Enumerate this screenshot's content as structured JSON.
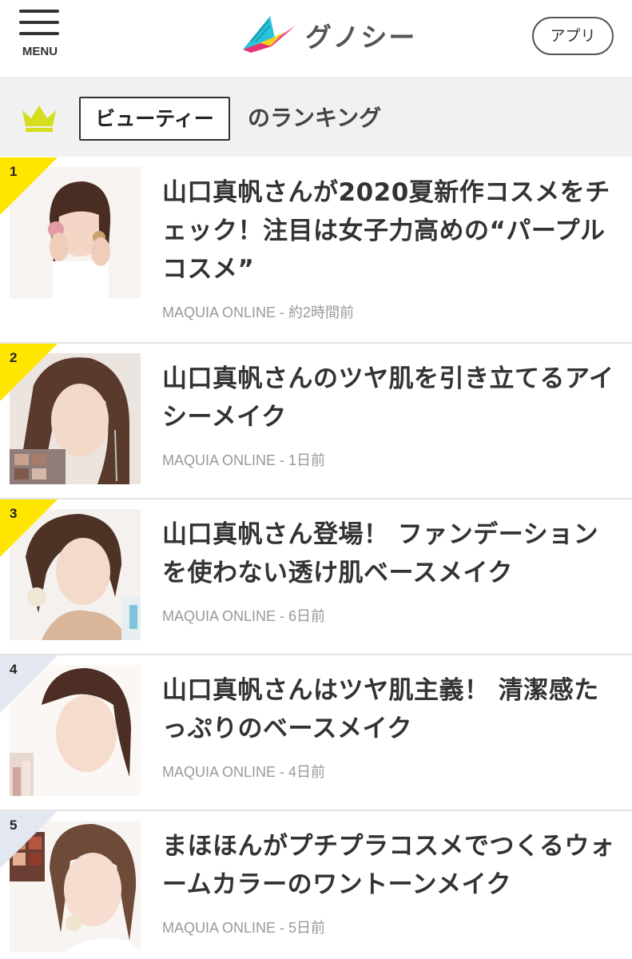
{
  "header": {
    "menu_label": "MENU",
    "logo_text": "グノシー",
    "app_button": "アプリ"
  },
  "ranking": {
    "category": "ビューティー",
    "suffix": "のランキング"
  },
  "colors": {
    "badge_top": "#ffe600",
    "badge_other": "#e3e8f0",
    "crown": "#d4dd1f",
    "meta": "#999999"
  },
  "articles": [
    {
      "rank": "1",
      "title": "山口真帆さんが2020夏新作コスメをチェック！注目は女子力高めの“パープルコスメ”",
      "source": "MAQUIA ONLINE",
      "time": "約2時間前"
    },
    {
      "rank": "2",
      "title": "山口真帆さんのツヤ肌を引き立てるアイシーメイク",
      "source": "MAQUIA ONLINE",
      "time": "1日前"
    },
    {
      "rank": "3",
      "title": "山口真帆さん登場！ ファンデーションを使わない透け肌ベースメイク",
      "source": "MAQUIA ONLINE",
      "time": "6日前"
    },
    {
      "rank": "4",
      "title": "山口真帆さんはツヤ肌主義！ 清潔感たっぷりのベースメイク",
      "source": "MAQUIA ONLINE",
      "time": "4日前"
    },
    {
      "rank": "5",
      "title": "まほほんがプチプラコスメでつくるウォームカラーのワントーンメイク",
      "source": "MAQUIA ONLINE",
      "time": "5日前"
    }
  ]
}
